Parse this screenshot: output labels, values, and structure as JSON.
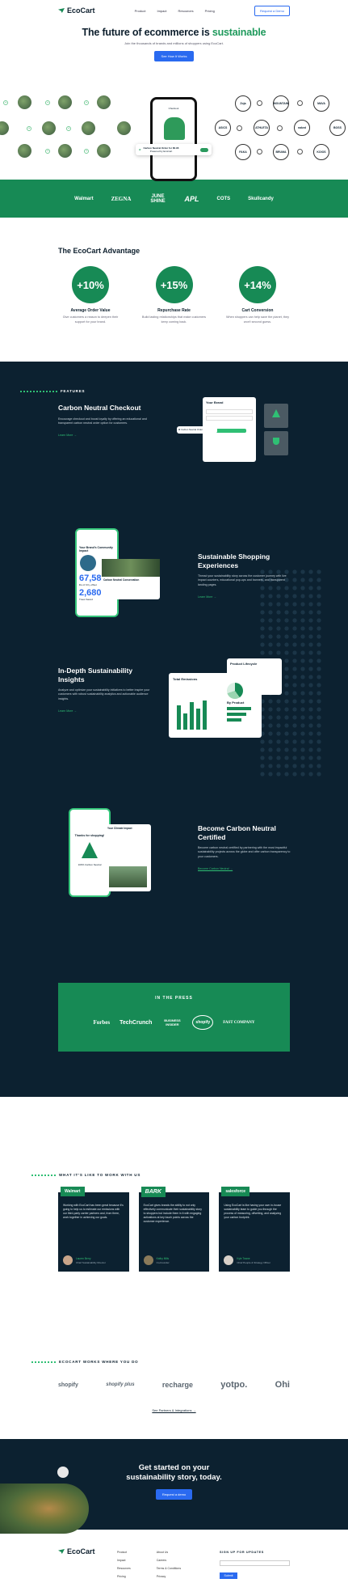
{
  "nav": {
    "brand": "EcoCart",
    "links": [
      "Product",
      "Impact",
      "Resources",
      "Pricing"
    ],
    "demo_button": "Request a Demo"
  },
  "hero": {
    "title_prefix": "The future of ecommerce is ",
    "title_highlight": "sustainable",
    "subtitle": "Join the thousands of brands and millions of shoppers using EcoCart.",
    "cta": "See How It Works",
    "phone_header": "Checkout",
    "toast_text": "Carbon Neutral Order for $0.96",
    "toast_sub": "Powered by EcoCart",
    "brand_circles": [
      "Zoja",
      "MOUNTAIN",
      "MAVA",
      "ASICS",
      "ATHLETA",
      "naked",
      "BOSS",
      "FAKA",
      "BRUMA",
      "KOIOS"
    ]
  },
  "logo_bar": [
    "Walmart",
    "ZEGNA",
    "JUNE SHINE",
    "APL",
    "COTS",
    "Skullcandy"
  ],
  "advantage": {
    "title": "The EcoCart Advantage",
    "stats": [
      {
        "value": "+10%",
        "label": "Average Order Value",
        "desc": "Give customers a reason to deepen their support for your brand."
      },
      {
        "value": "+15%",
        "label": "Repurchase Rate",
        "desc": "Build lasting relationships that make customers keep coming back."
      },
      {
        "value": "+14%",
        "label": "Cart Conversion",
        "desc": "When shoppers can help save the planet, they won't second guess."
      }
    ]
  },
  "features": {
    "eyebrow": "FEATURES",
    "items": [
      {
        "title": "Carbon Neutral Checkout",
        "desc": "Encourage checkout and boost loyalty by offering an educational and transparent carbon neutral order option for customers.",
        "link": "Learn More"
      },
      {
        "title": "Sustainable Shopping Experiences",
        "desc": "Thread your sustainability story across the customer journey with live impact counters, educational pop-ups and banners, and transparent landing pages.",
        "link": "Learn More"
      },
      {
        "title": "In-Depth Sustainability Insights",
        "desc": "Analyze and optimize your sustainability initiatives to better inspire your customers with robust sustainability analytics and actionable audience insights.",
        "link": "Learn More"
      },
      {
        "title": "Become Carbon Neutral Certified",
        "desc": "Become carbon neutral certified by partnering with the most impactful sustainability projects across the globe and offer carbon transparency to your customers.",
        "link": "Become Carbon Neutral"
      }
    ],
    "mock": {
      "your_brand": "Your Brand",
      "impact_title": "Your Brand's Community Impact",
      "impact_value_1": "67,58",
      "impact_label_1": "lbs of CO₂ offset",
      "impact_value_2": "2,680",
      "impact_label_2": "Trees Saved",
      "forest_title": "Carbon Neutral Conservation",
      "emissions_title": "Total Emissions",
      "lifecycle_title": "Product Lifecycle",
      "by_product": "By Product",
      "thanks": "Thanks for shopping!",
      "certified": "100% Carbon Neutral",
      "impact_card": "Your Climate Impact"
    }
  },
  "press": {
    "title": "IN THE PRESS",
    "logos": [
      "Forbes",
      "TechCrunch",
      "BUSINESS INSIDER",
      "shopify",
      "FAST COMPANY"
    ]
  },
  "testimonials": {
    "eyebrow": "WHAT IT'S LIKE TO WORK WITH US",
    "items": [
      {
        "brand": "Walmart",
        "quote": "Working with EcoCart has been great because it's going to help us to estimate our emissions with our third-party carrier partners and, from there, work together in achieving our goals.",
        "name": "Lauren Berry",
        "role": "Chief Sustainability Director"
      },
      {
        "brand": "BARK",
        "quote": "EcoCart gives brands the ability to not only effectively communicate their sustainability story to shoppers but include them in it with engaging activations at key touch points across the customer experience.",
        "name": "Kathy Mills",
        "role": "Co-Founder"
      },
      {
        "brand": "salesforce",
        "quote": "Using EcoCart is like having your own in-house sustainability team to guide you through the process of measuring, offsetting, and analyzing your carbon footprint.",
        "name": "Kyle Towne",
        "role": "Chief People & Strategy Officer"
      }
    ]
  },
  "works": {
    "eyebrow": "ECOCART WORKS WHERE YOU DO",
    "platforms": [
      "shopify",
      "shopify plus",
      "recharge",
      "yotpo.",
      "Ohi"
    ],
    "link": "See Partners & Integrations"
  },
  "cta": {
    "title_line1": "Get started on your",
    "title_line2": "sustainability story, today.",
    "button": "Request a demo"
  },
  "footer": {
    "brand": "EcoCart",
    "col1": [
      "Product",
      "Impact",
      "Resources",
      "Pricing"
    ],
    "col2": [
      "About Us",
      "Careers",
      "Terms & Conditions",
      "Privacy"
    ],
    "newsletter_title": "SIGN UP FOR UPDATES",
    "submit": "Submit"
  },
  "colors": {
    "brand_green": "#178a55",
    "navy": "#0c2130",
    "accent_blue": "#2a6af0",
    "bright_green": "#2fbf74"
  }
}
